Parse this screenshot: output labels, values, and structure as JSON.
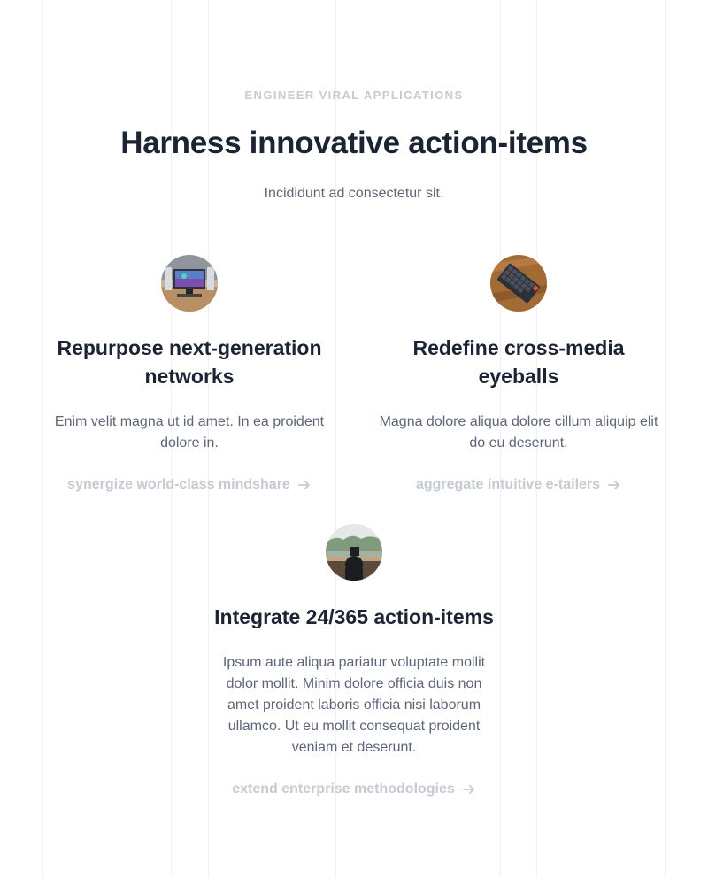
{
  "section": {
    "eyebrow": "ENGINEER VIRAL APPLICATIONS",
    "headline": "Harness innovative action-items",
    "subhead": "Incididunt ad consectetur sit."
  },
  "features": [
    {
      "image": "photo-desk-monitor",
      "title_line1": "Repurpose next-generation",
      "title_line2": "networks",
      "body_line1": "Enim velit magna ut id amet. In ea proident",
      "body_line2": "dolore in.",
      "link": "synergize world-class mindshare"
    },
    {
      "image": "photo-keyboard",
      "title_line1": "Redefine cross-media",
      "title_line2": "eyeballs",
      "body_line1": "Magna dolore aliqua dolore cillum aliquip elit",
      "body_line2": "do eu deserunt.",
      "link": "aggregate intuitive e-tailers"
    },
    {
      "image": "photo-workspace-view",
      "title_line1": "Integrate 24/365 action-items",
      "body_line1": "Ipsum aute aliqua pariatur voluptate mollit",
      "body_line2": "dolor mollit. Minim dolore officia duis non",
      "body_line3": "amet proident laboris officia nisi laborum",
      "body_line4": "ullamco. Ut eu mollit consequat proident",
      "body_line5": "veniam et deserunt.",
      "link": "extend enterprise methodologies"
    }
  ],
  "colors": {
    "heading": "#1c2333",
    "body": "#5d6677",
    "muted": "#c6cad1",
    "grid": "#f0f1f3"
  },
  "icons": {
    "link_arrow": "arrow-right-icon"
  }
}
